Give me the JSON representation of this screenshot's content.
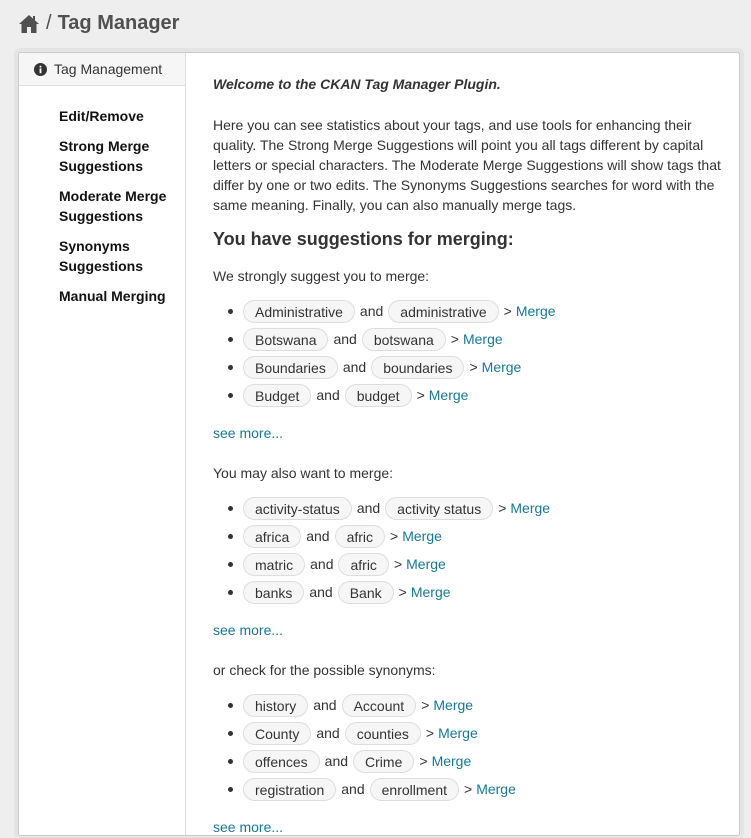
{
  "header": {
    "title": "Tag Manager",
    "separator": "/"
  },
  "sidebar": {
    "header_label": "Tag Management",
    "items": [
      {
        "label": "Edit/Remove"
      },
      {
        "label": "Strong Merge Suggestions"
      },
      {
        "label": "Moderate Merge Suggestions"
      },
      {
        "label": "Synonyms Suggestions"
      },
      {
        "label": "Manual Merging"
      }
    ]
  },
  "main": {
    "welcome": "Welcome to the CKAN Tag Manager Plugin.",
    "intro": "Here you can see statistics about your tags, and use tools for enhancing their quality. The Strong Merge Suggestions will point you all tags different by capital letters or special characters. The Moderate Merge Suggestions will show tags that differ by one or two edits. The Synonyms Suggestions searches for word with the same meaning. Finally, you can also manually merge tags.",
    "suggestions_title": "You have suggestions for merging:",
    "and_text": "and",
    "gt_text": ">",
    "merge_label": "Merge",
    "see_more_label": "see more...",
    "sections": [
      {
        "label": "We strongly suggest you to merge:",
        "pairs": [
          [
            "Administrative",
            "administrative"
          ],
          [
            "Botswana",
            "botswana"
          ],
          [
            "Boundaries",
            "boundaries"
          ],
          [
            "Budget",
            "budget"
          ]
        ]
      },
      {
        "label": "You may also want to merge:",
        "pairs": [
          [
            "activity-status",
            "activity status"
          ],
          [
            "africa",
            "afric"
          ],
          [
            "matric",
            "afric"
          ],
          [
            "banks",
            "Bank"
          ]
        ]
      },
      {
        "label": "or check for the possible synonyms:",
        "pairs": [
          [
            "history",
            "Account"
          ],
          [
            "County",
            "counties"
          ],
          [
            "offences",
            "Crime"
          ],
          [
            "registration",
            "enrollment"
          ]
        ]
      }
    ]
  },
  "colors": {
    "link": "#187794",
    "background": "#eeeeee"
  }
}
